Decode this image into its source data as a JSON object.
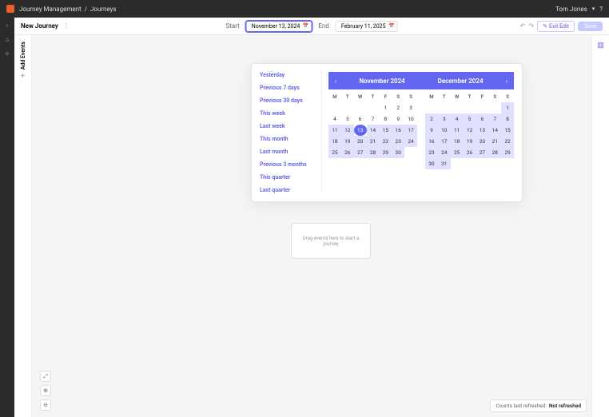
{
  "header": {
    "breadcrumb_parent": "Journey Management",
    "breadcrumb_sep": "/",
    "breadcrumb_current": "Journeys",
    "user_name": "Tom Jones"
  },
  "toolbar": {
    "title": "New Journey",
    "start_label": "Start",
    "start_value": "November 13, 2024",
    "end_label": "End",
    "end_value": "February 11, 2025",
    "exit_label": "Exit Edit",
    "save_label": "Save"
  },
  "sidebar": {
    "add_events": "Add Events"
  },
  "datepicker": {
    "presets": [
      "Yesterday",
      "Previous 7 days",
      "Previous 30 days",
      "This week",
      "Last week",
      "This month",
      "Last month",
      "Previous 3 months",
      "This quarter",
      "Last quarter"
    ],
    "month_left": "November 2024",
    "month_right": "December 2024",
    "dow": [
      "M",
      "T",
      "W",
      "T",
      "F",
      "S",
      "S"
    ],
    "nov": {
      "cells": [
        {
          "d": "",
          "m": 0
        },
        {
          "d": "",
          "m": 0
        },
        {
          "d": "",
          "m": 0
        },
        {
          "d": "",
          "m": 0
        },
        {
          "d": "1",
          "m": 0
        },
        {
          "d": "2",
          "m": 0
        },
        {
          "d": "3",
          "m": 0
        },
        {
          "d": "4",
          "m": 0
        },
        {
          "d": "5",
          "m": 0
        },
        {
          "d": "6",
          "m": 0
        },
        {
          "d": "7",
          "m": 0
        },
        {
          "d": "8",
          "m": 0
        },
        {
          "d": "9",
          "m": 0
        },
        {
          "d": "10",
          "m": 0
        },
        {
          "d": "11",
          "m": 1
        },
        {
          "d": "12",
          "m": 1
        },
        {
          "d": "13",
          "m": 2
        },
        {
          "d": "14",
          "m": 1
        },
        {
          "d": "15",
          "m": 1
        },
        {
          "d": "16",
          "m": 1
        },
        {
          "d": "17",
          "m": 1
        },
        {
          "d": "18",
          "m": 1
        },
        {
          "d": "19",
          "m": 1
        },
        {
          "d": "20",
          "m": 1
        },
        {
          "d": "21",
          "m": 1
        },
        {
          "d": "22",
          "m": 1
        },
        {
          "d": "23",
          "m": 1
        },
        {
          "d": "24",
          "m": 1
        },
        {
          "d": "25",
          "m": 1
        },
        {
          "d": "26",
          "m": 1
        },
        {
          "d": "27",
          "m": 1
        },
        {
          "d": "28",
          "m": 1
        },
        {
          "d": "29",
          "m": 1
        },
        {
          "d": "30",
          "m": 1
        },
        {
          "d": "",
          "m": 0
        }
      ]
    },
    "dec": {
      "cells": [
        {
          "d": "",
          "m": 0
        },
        {
          "d": "",
          "m": 0
        },
        {
          "d": "",
          "m": 0
        },
        {
          "d": "",
          "m": 0
        },
        {
          "d": "",
          "m": 0
        },
        {
          "d": "",
          "m": 0
        },
        {
          "d": "1",
          "m": 1
        },
        {
          "d": "2",
          "m": 1
        },
        {
          "d": "3",
          "m": 1
        },
        {
          "d": "4",
          "m": 1
        },
        {
          "d": "5",
          "m": 1
        },
        {
          "d": "6",
          "m": 1
        },
        {
          "d": "7",
          "m": 1
        },
        {
          "d": "8",
          "m": 1
        },
        {
          "d": "9",
          "m": 1
        },
        {
          "d": "10",
          "m": 1
        },
        {
          "d": "11",
          "m": 1
        },
        {
          "d": "12",
          "m": 1
        },
        {
          "d": "13",
          "m": 1
        },
        {
          "d": "14",
          "m": 1
        },
        {
          "d": "15",
          "m": 1
        },
        {
          "d": "16",
          "m": 1
        },
        {
          "d": "17",
          "m": 1
        },
        {
          "d": "18",
          "m": 1
        },
        {
          "d": "19",
          "m": 1
        },
        {
          "d": "20",
          "m": 1
        },
        {
          "d": "21",
          "m": 1
        },
        {
          "d": "22",
          "m": 1
        },
        {
          "d": "23",
          "m": 1
        },
        {
          "d": "24",
          "m": 1
        },
        {
          "d": "25",
          "m": 1
        },
        {
          "d": "26",
          "m": 1
        },
        {
          "d": "27",
          "m": 1
        },
        {
          "d": "28",
          "m": 1
        },
        {
          "d": "29",
          "m": 1
        },
        {
          "d": "30",
          "m": 1
        },
        {
          "d": "31",
          "m": 1
        },
        {
          "d": "",
          "m": 0
        },
        {
          "d": "",
          "m": 0
        },
        {
          "d": "",
          "m": 0
        },
        {
          "d": "",
          "m": 0
        },
        {
          "d": "",
          "m": 0
        }
      ]
    }
  },
  "dropzone": {
    "text": "Drag events here to start a journey"
  },
  "footer": {
    "label": "Counts last refreshed:",
    "value": "Not refreshed"
  }
}
